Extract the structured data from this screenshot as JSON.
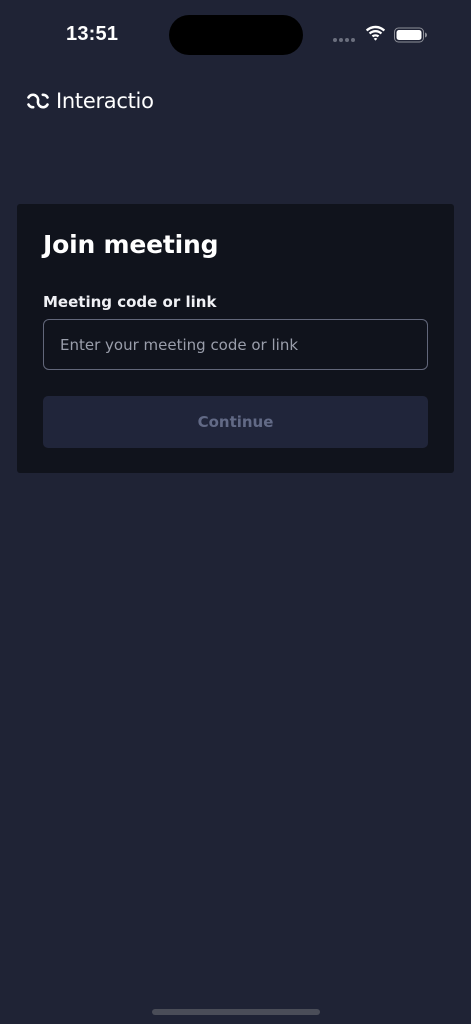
{
  "status_bar": {
    "time": "13:51",
    "icons": [
      "signal-dots-icon",
      "wifi-icon",
      "battery-icon"
    ]
  },
  "brand": {
    "logo_icon": "interactio-logo-icon",
    "name": "Interactio"
  },
  "join_card": {
    "title": "Join meeting",
    "field_label": "Meeting code or link",
    "input_value": "",
    "input_placeholder": "Enter your meeting code or link",
    "continue_label": "Continue",
    "continue_enabled": false
  },
  "colors": {
    "background": "#1f2335",
    "card": "#10131c",
    "input_border": "#62677a",
    "button_disabled_bg": "#20253a",
    "button_disabled_text": "#626a86"
  }
}
